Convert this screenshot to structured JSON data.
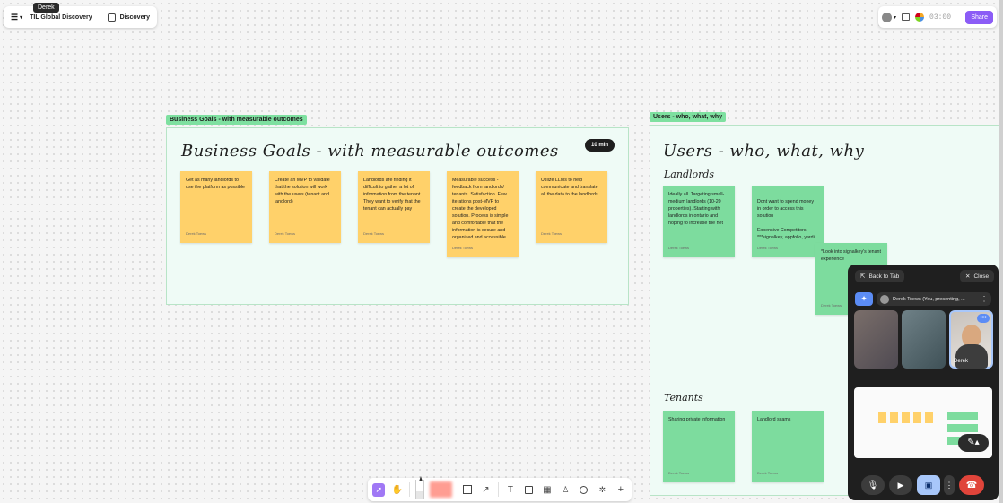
{
  "tooltip": "Derek",
  "header": {
    "board_title": "TIL Global Discovery",
    "tab_label": "Discovery"
  },
  "top_right": {
    "timer": "03:00",
    "share_label": "Share"
  },
  "business_goals": {
    "tag": "Business Goals - with measurable outcomes",
    "title": "Business Goals - with measurable outcomes",
    "timer_badge": "10 min",
    "stickies": [
      {
        "text": "Get as many landlords to use the platform as possible",
        "author": "Derek Toews"
      },
      {
        "text": "Create an MVP to validate that the solution will work with the users (tenant and landlord)",
        "author": "Derek Toews"
      },
      {
        "text": "Landlords are finding it difficult to gather a lot of information from the tenant. They want to verify that the tenant can actually pay",
        "author": "Derek Toews"
      },
      {
        "text": "Measurable success - feedback from landlords/ tenants. Satisfaction. Few iterations post-MVP to create the developed solution. Process is simple and comfortable that the information is secure and organized and accessible.",
        "author": "Derek Toews"
      },
      {
        "text": "Utilize LLMs to help communicate and translate all the data to the landlords",
        "author": "Derek Toews"
      }
    ]
  },
  "users": {
    "tag": "Users - who, what, why",
    "title": "Users - who, what, why",
    "landlords_label": "Landlords",
    "tenants_label": "Tenants",
    "landlord_stickies": [
      {
        "text": "Ideally all. Targeting small-medium landlords (10-20 properties). Starting with landlords in ontario and hoping to increase the net",
        "author": "Derek Toews"
      },
      {
        "text": "Dont want to spend money in order to access this solution\n\nExpensive Competitors - ***signalkey, appfolio, yardi",
        "author": "Derek Toews"
      },
      {
        "text": "*Look into signalkey's tenant experience",
        "author": "Derek Toews"
      }
    ],
    "tenant_stickies": [
      {
        "text": "Sharing private information",
        "author": "Derek Toews"
      },
      {
        "text": "Landlord scams",
        "author": "Derek Toews"
      }
    ]
  },
  "meet": {
    "back_label": "Back to Tab",
    "close_label": "Close",
    "presenter_label": "Derek Toews (You, presenting, ...",
    "self_name": "Derek"
  },
  "colors": {
    "accent": "#8b5cf6",
    "section_bg": "#effbf6",
    "yellow_sticky": "#ffd16a",
    "green_sticky": "#7ddc9e",
    "end_call": "#e0443a"
  }
}
